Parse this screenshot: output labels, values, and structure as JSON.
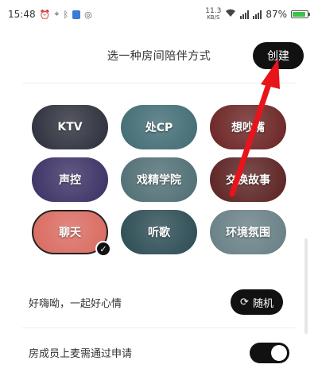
{
  "status_bar": {
    "time": "15:48",
    "net_speed": "11.3",
    "net_unit": "KB/S",
    "battery_percent": "87%",
    "battery_level": 0.87
  },
  "header": {
    "title": "选一种房间陪伴方式",
    "create_label": "创建"
  },
  "room_types": [
    {
      "label": "KTV",
      "selected": false,
      "color": "#2a2d3a"
    },
    {
      "label": "处CP",
      "selected": false,
      "color": "#3f6a72"
    },
    {
      "label": "想吵嘴",
      "selected": false,
      "color": "#6a2222"
    },
    {
      "label": "声控",
      "selected": false,
      "color": "#3a2f63"
    },
    {
      "label": "戏精学院",
      "selected": false,
      "color": "#4d6d72"
    },
    {
      "label": "交换故事",
      "selected": false,
      "color": "#5a2020"
    },
    {
      "label": "聊天",
      "selected": true,
      "color": "#d9695f"
    },
    {
      "label": "听歌",
      "selected": false,
      "color": "#2a4a52"
    },
    {
      "label": "环境氛围",
      "selected": false,
      "color": "#667e84"
    }
  ],
  "mood": {
    "text": "好嗨呦，一起好心情",
    "random_label": "随机"
  },
  "approval": {
    "label": "房成员上麦需通过申请",
    "enabled": true
  },
  "colors": {
    "accent": "#111111",
    "annotation_arrow": "#e8141c"
  }
}
